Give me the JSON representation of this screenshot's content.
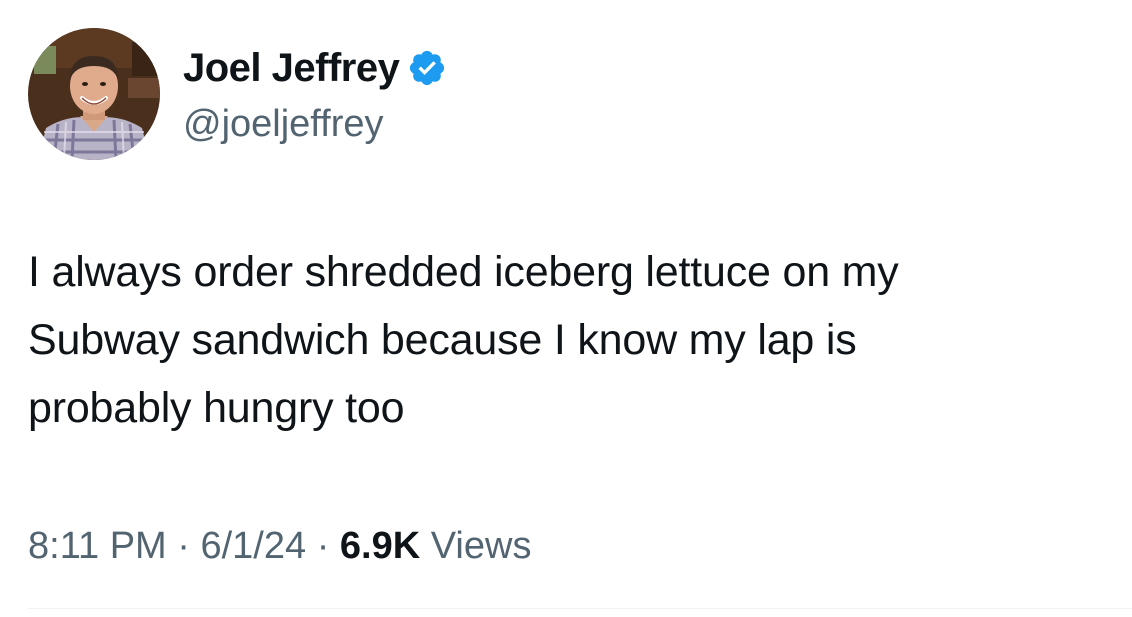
{
  "author": {
    "display_name": "Joel Jeffrey",
    "handle": "@joeljeffrey",
    "verified": true,
    "verified_icon": "verified-badge-icon",
    "verified_color": "#1d9bf0"
  },
  "tweet": {
    "text_lines": [
      "I always order shredded iceberg lettuce on my",
      "Subway sandwich because I know my lap is",
      "probably hungry too"
    ]
  },
  "meta": {
    "time": "8:11 PM",
    "separator": "·",
    "date": "6/1/24",
    "views_count": "6.9K",
    "views_label": "Views"
  },
  "colors": {
    "text_primary": "#0f1419",
    "text_secondary": "#536471",
    "divider": "#eff3f4"
  }
}
